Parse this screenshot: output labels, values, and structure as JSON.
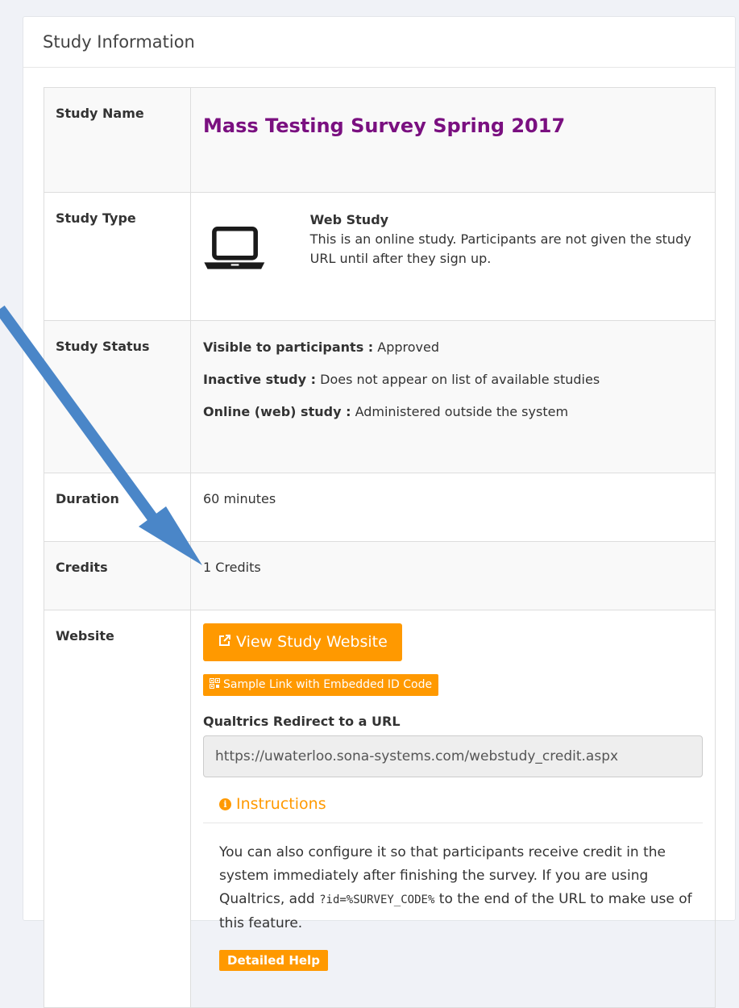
{
  "panel": {
    "title": "Study Information"
  },
  "rows": {
    "name": {
      "label": "Study Name",
      "value": "Mass Testing Survey Spring 2017"
    },
    "type": {
      "label": "Study Type",
      "title": "Web Study",
      "description": "This is an online study. Participants are not given the study URL until after they sign up."
    },
    "status": {
      "label": "Study Status",
      "lines": [
        {
          "key": "Visible to participants :",
          "value": "Approved"
        },
        {
          "key": "Inactive study :",
          "value": "Does not appear on list of available studies"
        },
        {
          "key": "Online (web) study :",
          "value": "Administered outside the system"
        }
      ]
    },
    "duration": {
      "label": "Duration",
      "value": "60 minutes"
    },
    "credits": {
      "label": "Credits",
      "value": "1 Credits"
    },
    "website": {
      "label": "Website",
      "view_button": "View Study Website",
      "sample_button": "Sample Link with Embedded ID Code",
      "redirect_label": "Qualtrics Redirect to a URL",
      "redirect_value": "https://uwaterloo.sona-systems.com/webstudy_credit.aspx",
      "instructions_title": "Instructions",
      "instructions_text_1": "You can also configure it so that participants receive credit in the system immediately after finishing the survey. If you are using Qualtrics, add",
      "instructions_code": "?id=%SURVEY_CODE%",
      "instructions_text_2": "to the end of the URL to make use of this feature.",
      "help_button": "Detailed Help"
    }
  },
  "colors": {
    "accent": "#ff9900",
    "study_name": "#7a1080",
    "arrow": "#4a86c8"
  },
  "icons": [
    "laptop-icon",
    "external-link-icon",
    "qr-code-icon",
    "info-icon",
    "arrow-annotation"
  ]
}
